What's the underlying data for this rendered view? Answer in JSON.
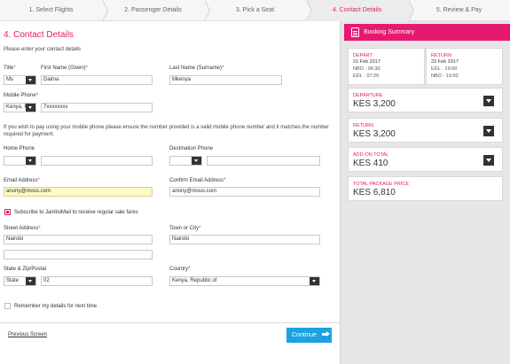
{
  "steps": [
    "1. Select Flights",
    "2. Passenger Details",
    "3. Pick a Seat",
    "4. Contact Details",
    "5. Review & Pay"
  ],
  "page": {
    "title": "4. Contact Details",
    "subtitle": "Please enter your contact details"
  },
  "form": {
    "title_label": "Title",
    "title_value": "Ms",
    "first_name_label": "First Name (Given)",
    "first_name_value": "Daima",
    "last_name_label": "Last Name (Surname)",
    "last_name_value": "Mkenya",
    "mobile_label": "Mobile Phone",
    "mobile_country": "Kenya, R",
    "mobile_value": "7xxxxxxxx",
    "mobile_note": "If you wish to pay using your mobile phone please ensure the number provided is a valid mobile phone number and it matches the number required for payment.",
    "home_phone_label": "Home Phone",
    "destination_phone_label": "Destination Phone",
    "email_label": "Email Address",
    "email_value": "anony@mous.com",
    "confirm_email_label": "Confirm Email Address",
    "confirm_email_value": "anony@mous.com",
    "subscribe_label": "Subscribe to JamboMail to receive regular sale fares",
    "street_label": "Street Address",
    "street_value": "Nairobi",
    "street2_value": "",
    "town_label": "Town or City",
    "town_value": "Nairobi",
    "state_label": "State & Zip/Postal",
    "state_value": "State",
    "zip_value": "02",
    "country_label": "Country",
    "country_value": "Kenya, Republic of",
    "remember_label": "Remember my details for next time",
    "required_mark": "*"
  },
  "footer": {
    "previous_label": "Previous Screen",
    "continue_label": "Continue"
  },
  "summary": {
    "header": "Booking Summary",
    "depart_label": "DEPART",
    "depart_date": "21 Feb 2017",
    "depart_line1": "NBO · 06:30",
    "depart_line2": "EDL · 07:20",
    "return_label": "RETURN",
    "return_date": "23 Feb 2017",
    "return_line1": "EDL · 19:00",
    "return_line2": "NBO · 19:50",
    "departure_label": "DEPARTURE",
    "departure_value": "KES 3,200",
    "return_price_label": "RETURN",
    "return_price_value": "KES 3,200",
    "addon_label": "ADD-ON TOTAL",
    "addon_value": "KES 410",
    "total_label": "TOTAL PACKAGE PRICE",
    "total_value": "KES 6,810"
  },
  "colors": {
    "accent": "#e5196f",
    "button": "#1aa3e0",
    "email_highlight": "#fdfac6"
  }
}
